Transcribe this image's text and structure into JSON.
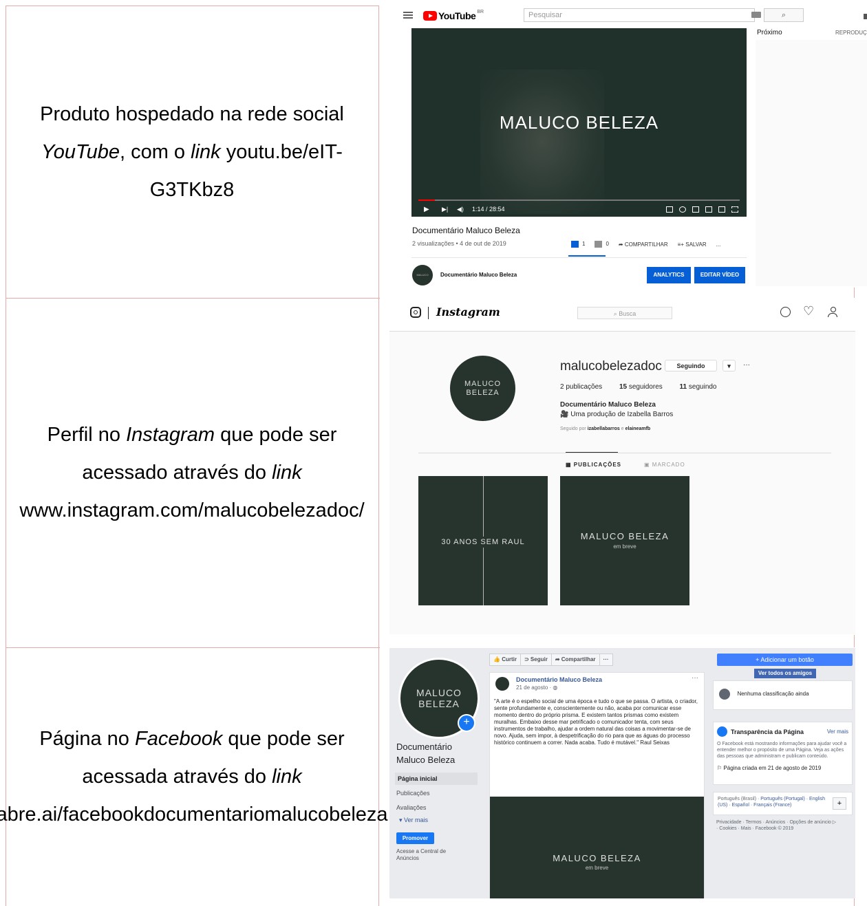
{
  "rows": [
    {
      "text_parts": [
        {
          "t": "Produto hospedado na rede social ",
          "i": false
        },
        {
          "t": "YouTube",
          "i": true
        },
        {
          "t": ", com o ",
          "i": false
        },
        {
          "t": "link",
          "i": true
        },
        {
          "t": " youtu.be/eIT-G3TKbz8",
          "i": false
        }
      ]
    },
    {
      "text_parts": [
        {
          "t": "Perfil no ",
          "i": false
        },
        {
          "t": "Instagram",
          "i": true
        },
        {
          "t": " que pode ser acessado através do ",
          "i": false
        },
        {
          "t": "link",
          "i": true
        },
        {
          "t": " www.instagram.com/malucobelezadoc/",
          "i": false
        }
      ]
    },
    {
      "text_parts": [
        {
          "t": "Página no ",
          "i": false
        },
        {
          "t": "Facebook",
          "i": true
        },
        {
          "t": " que pode ser acessada através do ",
          "i": false
        },
        {
          "t": "link",
          "i": true
        },
        {
          "t": " abre.ai/facebookdocumentariomalucobeleza",
          "i": false
        }
      ]
    }
  ],
  "youtube": {
    "logo_text": "YouTube",
    "region": "BR",
    "search_placeholder": "Pesquisar",
    "search_icon": "search-icon",
    "video_overlay_title": "MALUCO BELEZA",
    "time": "1:14 / 28:54",
    "next_label": "Próximo",
    "autoplay_label": "REPRODUÇ",
    "video_title": "Documentário Maluco Beleza",
    "meta": "2 visualizações • 4 de out de 2019",
    "likes": "1",
    "dislikes": "0",
    "share_label": "COMPARTILHAR",
    "save_label": "SALVAR",
    "more": "...",
    "channel_avatar_text": "MALUCO BELEZA",
    "channel_name": "Documentário Maluco Beleza",
    "analytics_label": "ANALYTICS",
    "edit_label": "EDITAR VÍDEO",
    "accent": "#065fd4"
  },
  "instagram": {
    "wordmark": "Instagram",
    "search_placeholder": "Busca",
    "avatar_line1": "MALUCO",
    "avatar_line2": "BELEZA",
    "username": "malucobelezadoc",
    "following_btn": "Seguindo",
    "dropdown": "▾",
    "more": "···",
    "posts": "2",
    "posts_label": "publicações",
    "followers": "15",
    "followers_label": "seguidores",
    "following": "11",
    "following_label": "seguindo",
    "full_name": "Documentário Maluco Beleza",
    "bio": "Uma produção de Izabella Barros",
    "followed_by_prefix": "Seguido por",
    "followed_by_1": "izabellabarros",
    "followed_by_and": "e",
    "followed_by_2": "elaineamfb",
    "tab_posts": "PUBLICAÇÕES",
    "tab_tagged": "MARCADO",
    "post1_text": "30 ANOS SEM RAUL",
    "post2_title": "MALUCO BELEZA",
    "post2_sub": "em breve"
  },
  "facebook": {
    "avatar_line1": "MALUCO",
    "avatar_line2": "BELEZA",
    "page_name": "Documentário Maluco Beleza",
    "nav": [
      "Página inicial",
      "Publicações",
      "Avaliações"
    ],
    "see_more": "Ver mais",
    "promote": "Promover",
    "central": "Acesse a Central de Anúncios",
    "toolbar": [
      "Curtir",
      "Seguir",
      "Compartilhar",
      "···"
    ],
    "post_author": "Documentário Maluco Beleza",
    "post_date": "21 de agosto · ",
    "post_more": "···",
    "post_text": "\"A arte é o espelho social de uma época e tudo o que se passa. O artista, o criador, sente profundamente e, conscientemente ou não, acaba por comunicar esse momento dentro do próprio prisma. E existem tantos prismas como existem muralhas. Embaixo desse mar petrificado o comunicador tenta, com seus instrumentos de trabalho, ajudar a ordem natural das coisas a movimentar-se de novo. Ajuda, sem impor, à despetrificação do rio para que as águas do processo histórico continuem a correr. Nada acaba. Tudo é mutável.\" Raul Seixas",
    "post_img_title": "MALUCO BELEZA",
    "post_img_sub": "em breve",
    "add_button": "+ Adicionar um botão",
    "see_all_friends": "Ver todos os amigos",
    "no_rating": "Nenhuma classificação ainda",
    "transparency_title": "Transparência da Página",
    "transparency_more": "Ver mais",
    "transparency_text": "O Facebook está mostrando informações para ajudar você a entender melhor o propósito de uma Página. Veja as ações das pessoas que administram e publicam conteúdo.",
    "page_created": "Página criada em 21 de agosto de 2019",
    "lang_current": "Português (Brasil) · ",
    "lang_links": "Português (Portugal) · English (US) · Español · Français (France)",
    "plus": "+",
    "footer": "Privacidade · Termos · Anúncios · Opções de anúncio ▷ · Cookies · Mais · Facebook © 2019",
    "accent": "#1877f2"
  }
}
